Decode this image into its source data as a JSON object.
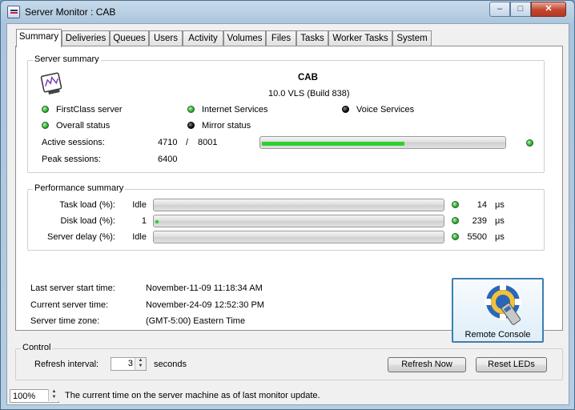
{
  "window": {
    "title": "Server Monitor : CAB",
    "buttons": {
      "minimize": "–",
      "maximize": "□",
      "close": "✕"
    }
  },
  "tabs": [
    "Summary",
    "Deliveries",
    "Queues",
    "Users",
    "Activity",
    "Volumes",
    "Files",
    "Tasks",
    "Worker Tasks",
    "System"
  ],
  "server_summary": {
    "group_label": "Server summary",
    "server_name": "CAB",
    "version": "10.0 VLS (Build 838)",
    "statuses": [
      {
        "label": "FirstClass server",
        "state": "green"
      },
      {
        "label": "Internet Services",
        "state": "green"
      },
      {
        "label": "Voice Services",
        "state": "off"
      },
      {
        "label": "Overall status",
        "state": "green"
      },
      {
        "label": "Mirror status",
        "state": "off"
      }
    ],
    "active_sessions_label": "Active sessions:",
    "active_sessions": "4710",
    "separator": "/",
    "max_sessions": "8001",
    "sessions_fraction": 0.5887,
    "peak_sessions_label": "Peak sessions:",
    "peak_sessions": "6400"
  },
  "performance": {
    "group_label": "Performance summary",
    "rows": [
      {
        "label": "Task load (%):",
        "value": "Idle",
        "fill": 0,
        "time": "14",
        "unit": "μs"
      },
      {
        "label": "Disk load (%):",
        "value": "1",
        "fill": 0.01,
        "time": "239",
        "unit": "μs"
      },
      {
        "label": "Server delay (%):",
        "value": "Idle",
        "fill": 0,
        "time": "5500",
        "unit": "μs"
      }
    ]
  },
  "times": {
    "start_label": "Last server start time:",
    "start_value": "November-11-09 11:18:34 AM",
    "current_label": "Current server time:",
    "current_value": "November-24-09 12:52:30 PM",
    "zone_label": "Server time zone:",
    "zone_value": "(GMT-5:00) Eastern Time"
  },
  "remote_console": {
    "label": "Remote Console"
  },
  "control": {
    "group_label": "Control",
    "refresh_label": "Refresh interval:",
    "refresh_value": "3",
    "refresh_unit": "seconds",
    "refresh_now": "Refresh Now",
    "reset_leds": "Reset LEDs"
  },
  "statusbar": {
    "zoom": "100%",
    "message": "The current time on the server machine as of last monitor update."
  }
}
